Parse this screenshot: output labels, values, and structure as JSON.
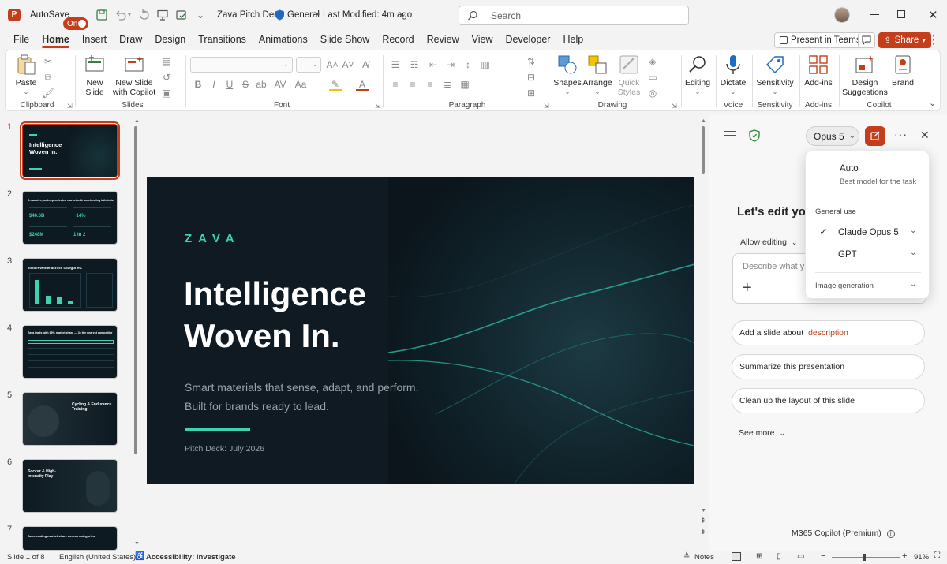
{
  "titlebar": {
    "autosave_label": "AutoSave",
    "autosave_state": "On",
    "doc_title": "Zava Pitch Deck",
    "sensitivity": "General",
    "modified": "Last Modified: 4m ago",
    "search_placeholder": "Search"
  },
  "tabs": [
    "File",
    "Home",
    "Insert",
    "Draw",
    "Design",
    "Transitions",
    "Animations",
    "Slide Show",
    "Record",
    "Review",
    "View",
    "Developer",
    "Help"
  ],
  "active_tab": "Home",
  "topright": {
    "present_teams": "Present in Teams",
    "share": "Share"
  },
  "ribbon": {
    "paste": "Paste",
    "clipboard": "Clipboard",
    "new_slide_1": "New",
    "new_slide_2": "Slide",
    "new_copilot_1": "New Slide",
    "new_copilot_2": "with Copilot",
    "slides": "Slides",
    "font": "Font",
    "paragraph": "Paragraph",
    "shapes": "Shapes",
    "arrange": "Arrange",
    "quick_styles_1": "Quick",
    "quick_styles_2": "Styles",
    "drawing": "Drawing",
    "editing": "Editing",
    "dictate": "Dictate",
    "voice": "Voice",
    "sensitivity": "Sensitivity",
    "sensitivity_grp": "Sensitivity",
    "addins": "Add-ins",
    "addins_grp": "Add-ins",
    "design_sugg_1": "Design",
    "design_sugg_2": "Suggestions",
    "brand": "Brand",
    "copilot_grp": "Copilot"
  },
  "thumbnails": [
    {
      "num": "1",
      "title": "Intelligence Woven In."
    },
    {
      "num": "2",
      "title": "A massive, under-penetrated market with accelerating tailwinds."
    },
    {
      "num": "3",
      "title": "2025 revenue across categories."
    },
    {
      "num": "4",
      "title": "Zava leads with 15% market share — 3x the nearest competitor"
    },
    {
      "num": "5",
      "title": "Cycling & Endurance Training"
    },
    {
      "num": "6",
      "title": "Soccer & High-Intensity Play"
    },
    {
      "num": "7",
      "title": "Accelerating market share across categories."
    }
  ],
  "slide": {
    "brand": "ZAVA",
    "headline_1": "Intelligence",
    "headline_2": "Woven In.",
    "sub_1": "Smart materials that sense, adapt, and perform.",
    "sub_2": "Built for brands ready to lead.",
    "footer": "Pitch Deck: July 2026"
  },
  "copilot": {
    "model_button": "Opus 5",
    "heading": "Let's edit yo",
    "allow_editing": "Allow editing",
    "input_placeholder": "Describe what y",
    "suggestions": [
      {
        "pre": "Add a slide about ",
        "accent": "description"
      },
      {
        "pre": "Summarize this presentation",
        "accent": ""
      },
      {
        "pre": "Clean up the layout of this slide",
        "accent": ""
      }
    ],
    "see_more": "See more",
    "footer": "M365 Copilot (Premium)",
    "menu": {
      "auto_title": "Auto",
      "auto_desc": "Best model for the task",
      "general_use": "General use",
      "claude": "Claude Opus 5",
      "gpt": "GPT",
      "image_gen": "Image generation"
    }
  },
  "status": {
    "slide_of": "Slide 1 of 8",
    "language": "English (United States)",
    "accessibility": "Accessibility: Investigate",
    "notes": "Notes",
    "zoom": "91%"
  },
  "colors": {
    "accent": "#c43e1c",
    "teal": "#3cd3b0",
    "slide_bg": "#0f1a22"
  }
}
